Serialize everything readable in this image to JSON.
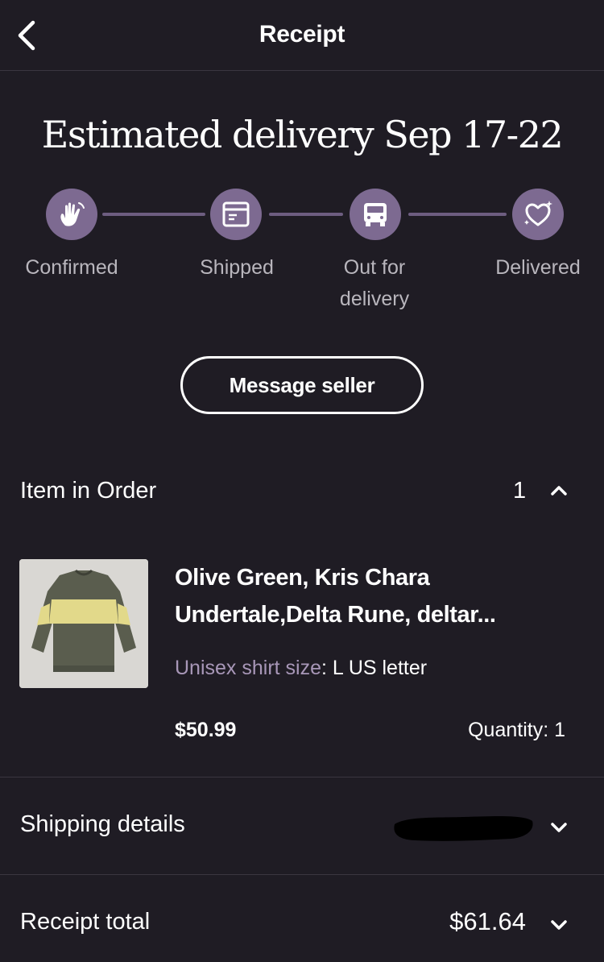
{
  "header": {
    "title": "Receipt"
  },
  "delivery": {
    "estimate": "Estimated delivery Sep 17-22",
    "steps": [
      {
        "label": "Confirmed",
        "icon": "wave-hand-icon"
      },
      {
        "label": "Shipped",
        "icon": "package-icon"
      },
      {
        "label_line1": "Out for",
        "label_line2": "delivery",
        "icon": "truck-icon"
      },
      {
        "label": "Delivered",
        "icon": "heart-sparkle-icon"
      }
    ]
  },
  "actions": {
    "message_seller": "Message seller"
  },
  "order": {
    "section_title": "Item in Order",
    "count": "1",
    "item": {
      "title_line1": "Olive Green, Kris Chara",
      "title_line2": "Undertale,Delta Rune, deltar...",
      "variation_label": "Unisex shirt size",
      "variation_value": ": L US letter",
      "price": "$50.99",
      "quantity": "Quantity: 1"
    }
  },
  "shipping": {
    "title": "Shipping details"
  },
  "receipt_total": {
    "title": "Receipt total",
    "amount": "$61.64"
  },
  "colors": {
    "background": "#1f1c24",
    "accent": "#7d6a91",
    "muted": "#a897b8"
  }
}
